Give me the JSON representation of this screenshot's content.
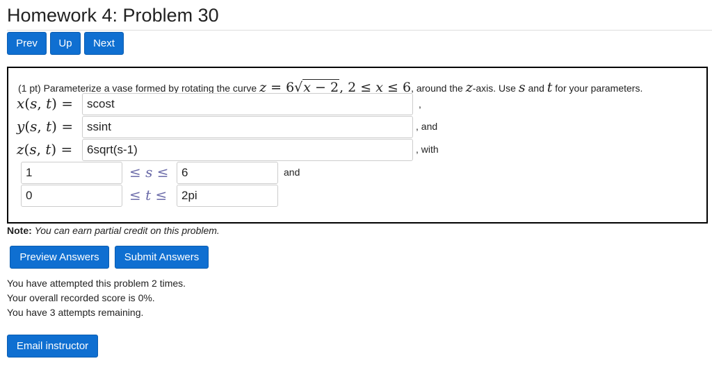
{
  "page_title": "Homework 4: Problem 30",
  "nav": {
    "prev": "Prev",
    "up": "Up",
    "next": "Next"
  },
  "problem": {
    "points": "(1 pt) Parameterize a vase formed by rotating the curve",
    "around_text": "around the",
    "axis_text": "-axis. Use",
    "and_text": "and",
    "for_params_text": "for your parameters.",
    "x_label": "x(s, t)",
    "y_label": "y(s, t)",
    "z_label": "z(s, t)",
    "x_value": "scost",
    "y_value": "ssint",
    "z_value": "6sqrt(s-1)",
    "x_after": ",",
    "y_after": ", and",
    "z_after": ", with",
    "s_lower": "1",
    "s_upper": "6",
    "t_lower": "0",
    "t_upper": "2pi",
    "s_after": "and"
  },
  "note": {
    "label": "Note:",
    "text": "You can earn partial credit on this problem."
  },
  "actions": {
    "preview": "Preview Answers",
    "submit": "Submit Answers"
  },
  "status": {
    "attempted": "You have attempted this problem 2 times.",
    "score": "Your overall recorded score is 0%.",
    "remaining": "You have 3 attempts remaining."
  },
  "email": "Email instructor",
  "colors": {
    "button_bg": "#0f6fd1",
    "button_text": "#ffffff",
    "box_border": "#000000"
  }
}
